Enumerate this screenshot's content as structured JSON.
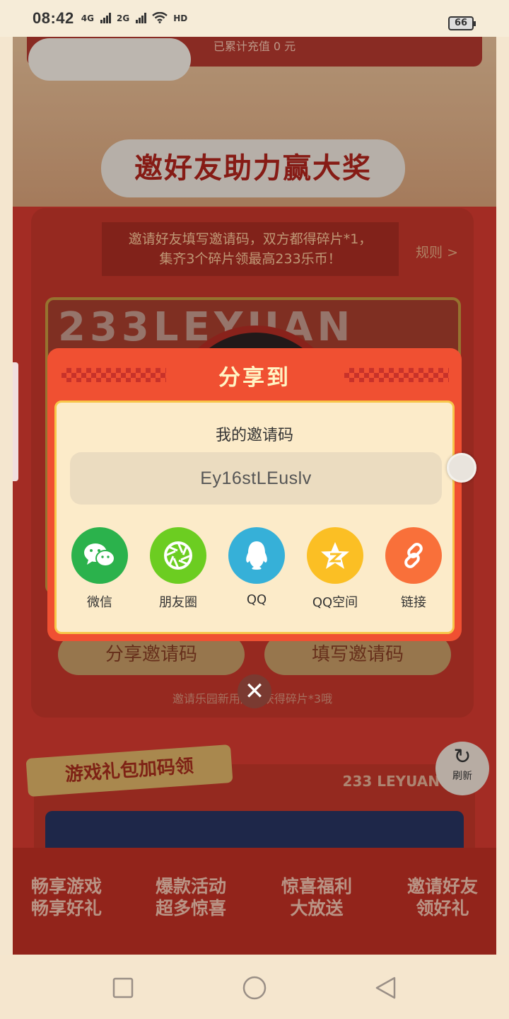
{
  "status_bar": {
    "time": "08:42",
    "network_1": "4G",
    "network_2": "2G",
    "hd_label": "HD",
    "battery": "66"
  },
  "background": {
    "total_recharge": "已累计充值 0 元",
    "title": "邀好友助力赢大奖",
    "invite_banner_line1": "邀请好友填写邀请码，双方都得碎片*1，",
    "invite_banner_line2": "集齐3个碎片领最高233乐币！",
    "rules_link": "规则 >",
    "poster_text": "233LEYUAN",
    "share_code_button": "分享邀请码",
    "enter_code_button": "填写邀请码",
    "note": "邀请乐园新用户可获得碎片*3哦",
    "gift_title": "游戏礼包加码领",
    "leyuan_mark": "233 LEYUAN",
    "refresh_label": "刷新",
    "promos": [
      {
        "line1": "畅享游戏",
        "line2": "畅享好礼"
      },
      {
        "line1": "爆款活动",
        "line2": "超多惊喜"
      },
      {
        "line1": "惊喜福利",
        "line2": "大放送"
      },
      {
        "line1": "邀请好友",
        "line2": "领好礼"
      }
    ]
  },
  "modal": {
    "title": "分享到",
    "code_label": "我的邀请码",
    "invite_code": "Ey16stLEuslv",
    "share_targets": [
      {
        "label": "微信",
        "icon": "wechat-icon",
        "color": "#2bb24c"
      },
      {
        "label": "朋友圈",
        "icon": "moments-icon",
        "color": "#6ccd21"
      },
      {
        "label": "QQ",
        "icon": "qq-icon",
        "color": "#36b0d8"
      },
      {
        "label": "QQ空间",
        "icon": "qzone-icon",
        "color": "#fbbf24"
      },
      {
        "label": "链接",
        "icon": "link-icon",
        "color": "#f9703a"
      }
    ],
    "close": "✕"
  },
  "colors": {
    "modal_red": "#f05032",
    "modal_cream": "#fcebc9",
    "title_gold": "#fff4c4"
  }
}
